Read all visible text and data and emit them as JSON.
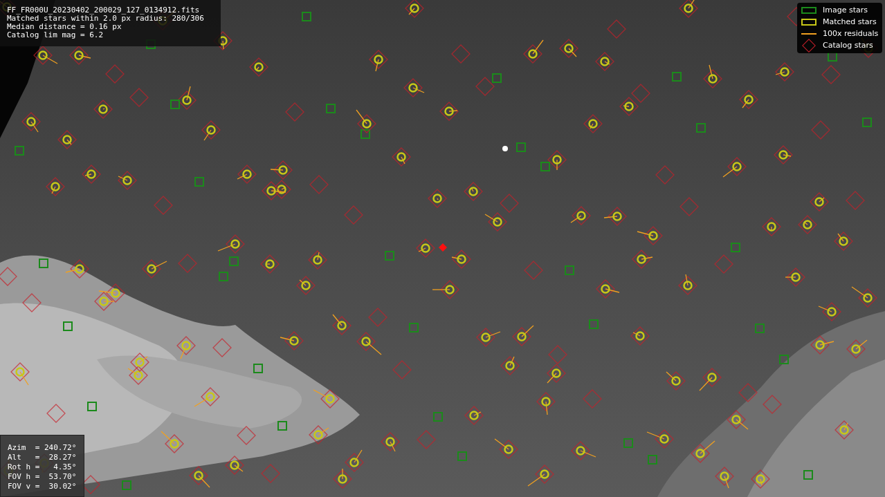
{
  "header": {
    "lines": [
      "FF_FR000U_20230402_200029_127_0134912.fits",
      "Matched stars within 2.0 px radius: 280/306",
      "Median distance = 0.16 px",
      "Catalog lim mag = 6.2"
    ]
  },
  "legend": [
    {
      "label": "Image stars"
    },
    {
      "kind": "matched",
      "label": "Matched stars"
    },
    {
      "kind": "residual",
      "label": "100x residuals"
    },
    {
      "kind": "catalog",
      "label": "Catalog stars"
    }
  ],
  "pointing": {
    "lines": [
      "Azim  = 240.72°",
      "Alt   =  28.27°",
      "Rot h =   4.35°",
      "FOV h =  53.70°",
      "FOV v =  30.02°"
    ]
  }
}
